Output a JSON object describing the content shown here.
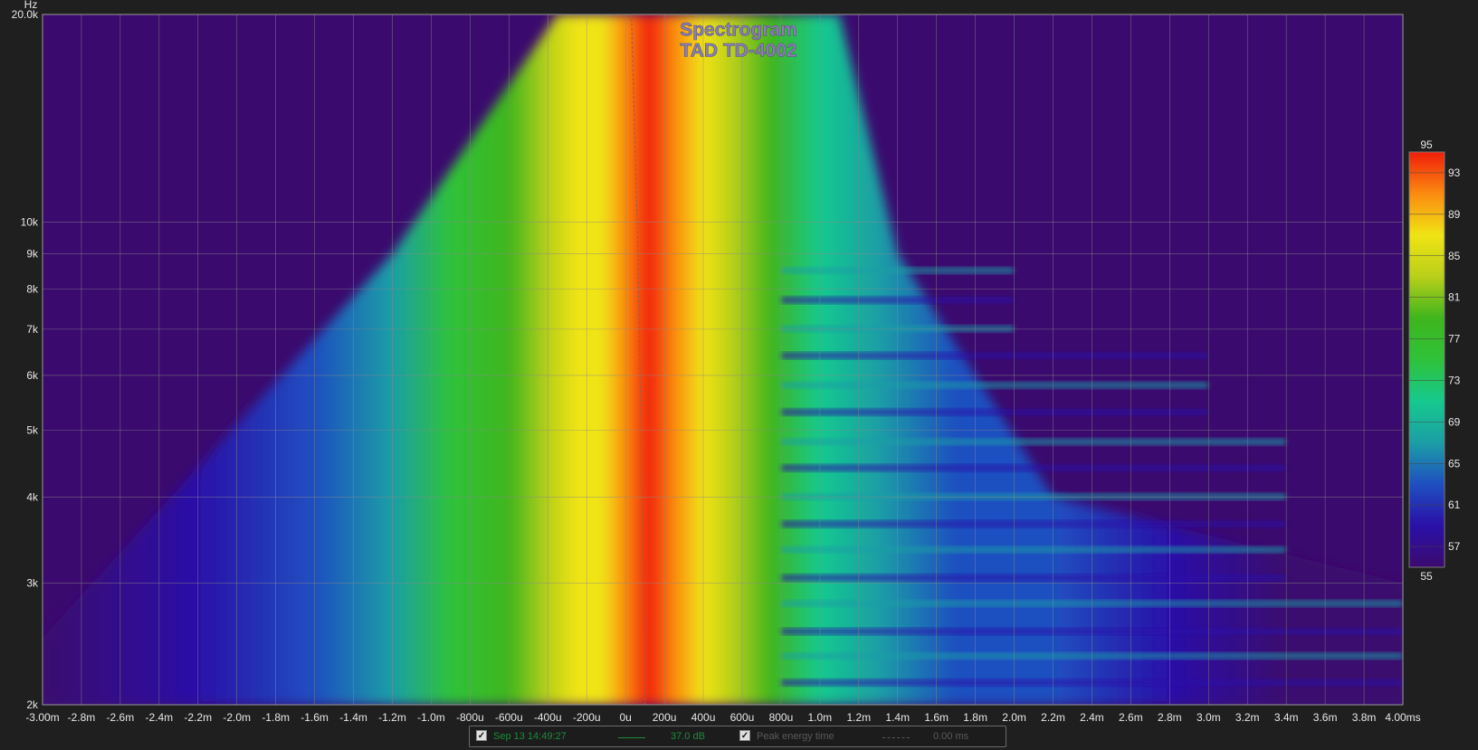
{
  "chart_data": {
    "type": "heatmap",
    "title": "Spectrogram",
    "subtitle": "TAD TD-4002",
    "ylabel": "Hz",
    "xlim_ms": [
      -3.0,
      4.0
    ],
    "ylim_hz": [
      2000,
      20000
    ],
    "y_scale": "log",
    "x_ticks": [
      {
        "v": -3.0,
        "label": "-3.00m"
      },
      {
        "v": -2.8,
        "label": "-2.8m"
      },
      {
        "v": -2.6,
        "label": "-2.6m"
      },
      {
        "v": -2.4,
        "label": "-2.4m"
      },
      {
        "v": -2.2,
        "label": "-2.2m"
      },
      {
        "v": -2.0,
        "label": "-2.0m"
      },
      {
        "v": -1.8,
        "label": "-1.8m"
      },
      {
        "v": -1.6,
        "label": "-1.6m"
      },
      {
        "v": -1.4,
        "label": "-1.4m"
      },
      {
        "v": -1.2,
        "label": "-1.2m"
      },
      {
        "v": -1.0,
        "label": "-1.0m"
      },
      {
        "v": -0.8,
        "label": "-800u"
      },
      {
        "v": -0.6,
        "label": "-600u"
      },
      {
        "v": -0.4,
        "label": "-400u"
      },
      {
        "v": -0.2,
        "label": "-200u"
      },
      {
        "v": 0.0,
        "label": "0u"
      },
      {
        "v": 0.2,
        "label": "200u"
      },
      {
        "v": 0.4,
        "label": "400u"
      },
      {
        "v": 0.6,
        "label": "600u"
      },
      {
        "v": 0.8,
        "label": "800u"
      },
      {
        "v": 1.0,
        "label": "1.0m"
      },
      {
        "v": 1.2,
        "label": "1.2m"
      },
      {
        "v": 1.4,
        "label": "1.4m"
      },
      {
        "v": 1.6,
        "label": "1.6m"
      },
      {
        "v": 1.8,
        "label": "1.8m"
      },
      {
        "v": 2.0,
        "label": "2.0m"
      },
      {
        "v": 2.2,
        "label": "2.2m"
      },
      {
        "v": 2.4,
        "label": "2.4m"
      },
      {
        "v": 2.6,
        "label": "2.6m"
      },
      {
        "v": 2.8,
        "label": "2.8m"
      },
      {
        "v": 3.0,
        "label": "3.0m"
      },
      {
        "v": 3.2,
        "label": "3.2m"
      },
      {
        "v": 3.4,
        "label": "3.4m"
      },
      {
        "v": 3.6,
        "label": "3.6m"
      },
      {
        "v": 3.8,
        "label": "3.8m"
      },
      {
        "v": 4.0,
        "label": "4.00ms"
      }
    ],
    "y_ticks": [
      {
        "v": 2000,
        "label": "2k"
      },
      {
        "v": 3000,
        "label": "3k"
      },
      {
        "v": 4000,
        "label": "4k"
      },
      {
        "v": 5000,
        "label": "5k"
      },
      {
        "v": 6000,
        "label": "6k"
      },
      {
        "v": 7000,
        "label": "7k"
      },
      {
        "v": 8000,
        "label": "8k"
      },
      {
        "v": 9000,
        "label": "9k"
      },
      {
        "v": 10000,
        "label": "10k"
      },
      {
        "v": 20000,
        "label": "20.0k"
      }
    ],
    "colorbar": {
      "min": 55,
      "max": 95,
      "labels": [
        "95",
        "93",
        "89",
        "85",
        "81",
        "77",
        "73",
        "69",
        "65",
        "61",
        "57",
        "55"
      ],
      "label_values": [
        95,
        93,
        89,
        85,
        81,
        77,
        73,
        69,
        65,
        61,
        57,
        55
      ],
      "stops": [
        {
          "db": 55,
          "color": "#3b0a6e"
        },
        {
          "db": 59,
          "color": "#2a10a8"
        },
        {
          "db": 63,
          "color": "#1f4fc0"
        },
        {
          "db": 67,
          "color": "#1b9ea6"
        },
        {
          "db": 71,
          "color": "#16c98e"
        },
        {
          "db": 75,
          "color": "#2fc23a"
        },
        {
          "db": 79,
          "color": "#3fb51d"
        },
        {
          "db": 83,
          "color": "#b9cf1a"
        },
        {
          "db": 87,
          "color": "#f0e414"
        },
        {
          "db": 91,
          "color": "#fb8a10"
        },
        {
          "db": 95,
          "color": "#f01e0a"
        }
      ]
    },
    "grid": true,
    "ridge": [
      {
        "hz": 20000,
        "ms": 0.03
      },
      {
        "hz": 10000,
        "ms": 0.06
      },
      {
        "hz": 5000,
        "ms": 0.08
      },
      {
        "hz": 3000,
        "ms": 0.09
      },
      {
        "hz": 2000,
        "ms": 0.1
      }
    ],
    "colors": {
      "background": "#3b0a6e",
      "grid": "#8a8a8a",
      "peak_curve": "#a05a48"
    }
  },
  "legend": {
    "item1_checked": "✓",
    "item1_label": "Sep 13 14:49:27",
    "item1_value": "37.0 dB",
    "item2_checked": "✓",
    "item2_label": "Peak energy time",
    "item2_value": "0.00 ms",
    "colors": {
      "item1": "#1d8a3a",
      "item2": "#5a5a5a"
    }
  }
}
